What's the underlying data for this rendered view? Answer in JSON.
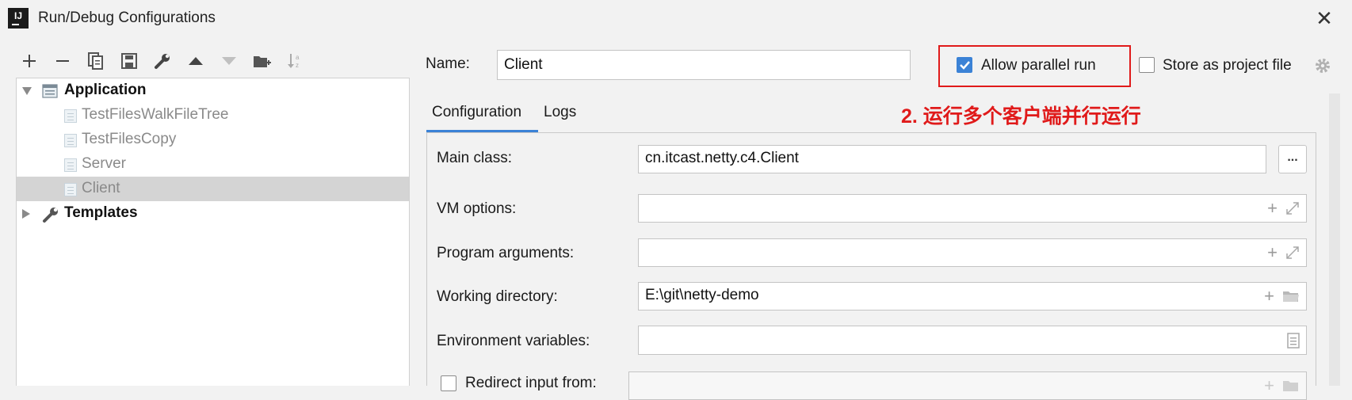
{
  "window": {
    "title": "Run/Debug Configurations",
    "app_icon_text": "IJ",
    "close_glyph": "✕"
  },
  "toolbar": {
    "icons": [
      "add-icon",
      "remove-icon",
      "copy-icon",
      "save-icon",
      "wrench-icon",
      "move-up-icon",
      "move-down-icon",
      "new-folder-icon",
      "sort-icon"
    ]
  },
  "tree": {
    "application": {
      "label": "Application"
    },
    "children": [
      {
        "label": "TestFilesWalkFileTree"
      },
      {
        "label": "TestFilesCopy"
      },
      {
        "label": "Server"
      },
      {
        "label": "Client"
      }
    ],
    "selected": "Client",
    "templates": {
      "label": "Templates"
    }
  },
  "form": {
    "name_label": "Name:",
    "name_value": "Client",
    "allow_parallel_label": "Allow parallel run",
    "allow_parallel_checked": true,
    "store_project_label": "Store as project file",
    "store_project_checked": false,
    "tabs": [
      {
        "label": "Configuration",
        "active": true
      },
      {
        "label": "Logs",
        "active": false
      }
    ],
    "main_class_label": "Main class:",
    "main_class_value": "cn.itcast.netty.c4.Client",
    "browse_label": "...",
    "vm_options_label": "VM options:",
    "vm_options_value": "",
    "program_args_label": "Program arguments:",
    "program_args_value": "",
    "working_dir_label": "Working directory:",
    "working_dir_value": "E:\\git\\netty-demo",
    "env_vars_label": "Environment variables:",
    "env_vars_value": "",
    "redirect_label": "Redirect input from:"
  },
  "annotation": {
    "text": "2. 运行多个客户端并行运行",
    "color": "#e01a1a"
  },
  "colors": {
    "accent": "#3b82d6",
    "selection": "#d4d4d4",
    "annotation": "#e01a1a"
  }
}
